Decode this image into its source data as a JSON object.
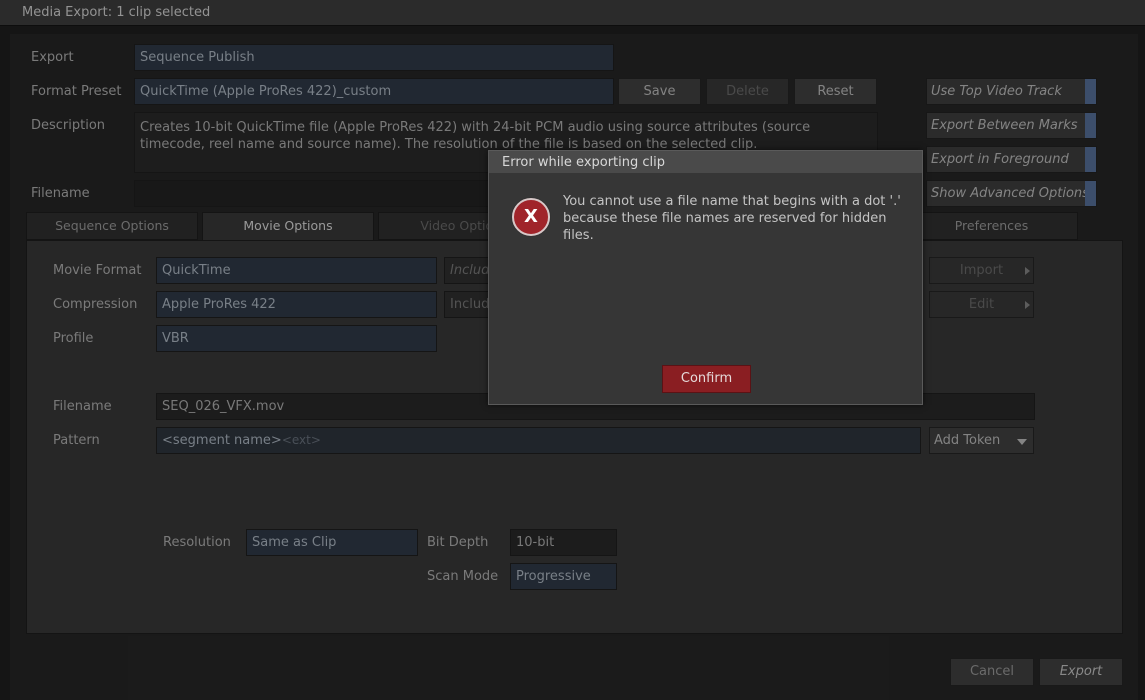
{
  "window": {
    "title": "Media Export: 1 clip selected"
  },
  "export": {
    "label": "Export",
    "value": "Sequence Publish"
  },
  "format_preset": {
    "label": "Format Preset",
    "value": "QuickTime (Apple ProRes 422)_custom",
    "save": "Save",
    "delete": "Delete",
    "reset": "Reset"
  },
  "description": {
    "label": "Description",
    "text": "Creates 10-bit QuickTime file (Apple ProRes 422) with 24-bit PCM audio using source attributes (source timecode, reel name and source name). The resolution of the file is based on the selected clip."
  },
  "filename_top": {
    "label": "Filename",
    "value": ""
  },
  "side_options": [
    {
      "label": "Use Top Video Track",
      "enabled": true
    },
    {
      "label": "Export Between Marks",
      "enabled": true
    },
    {
      "label": "Export in Foreground",
      "enabled": true
    },
    {
      "label": "Show Advanced Options",
      "enabled": true
    }
  ],
  "tabs": [
    "Sequence Options",
    "Movie Options",
    "Video Options",
    "Preferences"
  ],
  "active_tab": "Movie Options",
  "movie": {
    "movie_format": {
      "label": "Movie Format",
      "value": "QuickTime"
    },
    "compression": {
      "label": "Compression",
      "value": "Apple ProRes 422"
    },
    "profile": {
      "label": "Profile",
      "value": "VBR"
    },
    "include_1": "Include",
    "include_2": "Include",
    "import_label": "Import",
    "edit_label": "Edit",
    "filename": {
      "label": "Filename",
      "value": "SEQ_026_VFX.mov"
    },
    "pattern": {
      "label": "Pattern",
      "value": "<segment name>",
      "ext": "<ext>"
    },
    "add_token": "Add Token",
    "resolution": {
      "label": "Resolution",
      "value": "Same as Clip"
    },
    "bit_depth": {
      "label": "Bit Depth",
      "value": "10-bit"
    },
    "scan_mode": {
      "label": "Scan Mode",
      "value": "Progressive"
    }
  },
  "footer": {
    "cancel": "Cancel",
    "export": "Export"
  },
  "dialog": {
    "title": "Error while exporting clip",
    "icon": "error-x-icon",
    "icon_glyph": "X",
    "message": "You cannot use a file name that begins with a dot '.' because these file names are reserved for hidden files.",
    "confirm": "Confirm"
  }
}
